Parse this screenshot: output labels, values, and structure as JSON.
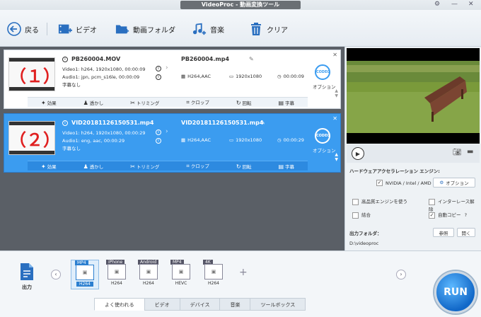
{
  "window": {
    "title": "VideoProc - 動画変換ツール",
    "minimize": "—",
    "close": "✕"
  },
  "toolbar": {
    "back_label": "戻る",
    "video_label": "ビデオ",
    "folder_label": "動画フォルダ",
    "music_label": "音楽",
    "clear_label": "クリア"
  },
  "items": [
    {
      "thumb_num": "（１）",
      "src_name": "PB260004.MOV",
      "video_info": "Video1: h264, 1920x1080, 00:00:09",
      "audio_info": "Audio1: jpn, pcm_s16le, 00:00:09",
      "subtitle_info": "字幕なし",
      "out_name": "PB260004.mp4",
      "codec": "H264,AAC",
      "resolution": "1920x1080",
      "duration": "00:00:09",
      "codec_badge": "CODEC",
      "option_label": "オプション"
    },
    {
      "thumb_num": "（２）",
      "src_name": "VID20181126150531.mp4",
      "video_info": "Video1: h264, 1920x1080, 00:00:29",
      "audio_info": "Audio1: eng, aac, 00:00:29",
      "subtitle_info": "字幕なし",
      "out_name": "VID20181126150531.mp4",
      "codec": "H264,AAC",
      "resolution": "1920x1080",
      "duration": "00:00:29",
      "codec_badge": "CODEC",
      "option_label": "オプション"
    }
  ],
  "edit_bar": [
    "効果",
    "透かし",
    "トリミング",
    "クロップ",
    "回転",
    "字幕"
  ],
  "right": {
    "hw_title": "ハードウェアアクセラレーション エンジン:",
    "hw_gpu": "NVIDIA / Intel / AMD",
    "hw_option": "オプション",
    "high_quality": "高品質エンジンを使う",
    "deinterlace": "インターレース解除",
    "merge": "結合",
    "auto_copy": "自動コピー",
    "help": "?",
    "output_folder_label": "出力フォルダ：",
    "browse": "参照",
    "open": "開く",
    "output_path": "D:\\videoproc"
  },
  "bottom": {
    "output_label": "出力",
    "formats": [
      {
        "tag": "MP4",
        "sub": "H264"
      },
      {
        "tag": "iPhone",
        "sub": "H264"
      },
      {
        "tag": "Android",
        "sub": "H264"
      },
      {
        "tag": "MP4",
        "sub": "HEVC"
      },
      {
        "tag": "4K",
        "sub": "H264"
      }
    ],
    "add": "+",
    "tabs": [
      "よく使われる",
      "ビデオ",
      "デバイス",
      "音楽",
      "ツールボックス"
    ],
    "run": "RUN"
  }
}
